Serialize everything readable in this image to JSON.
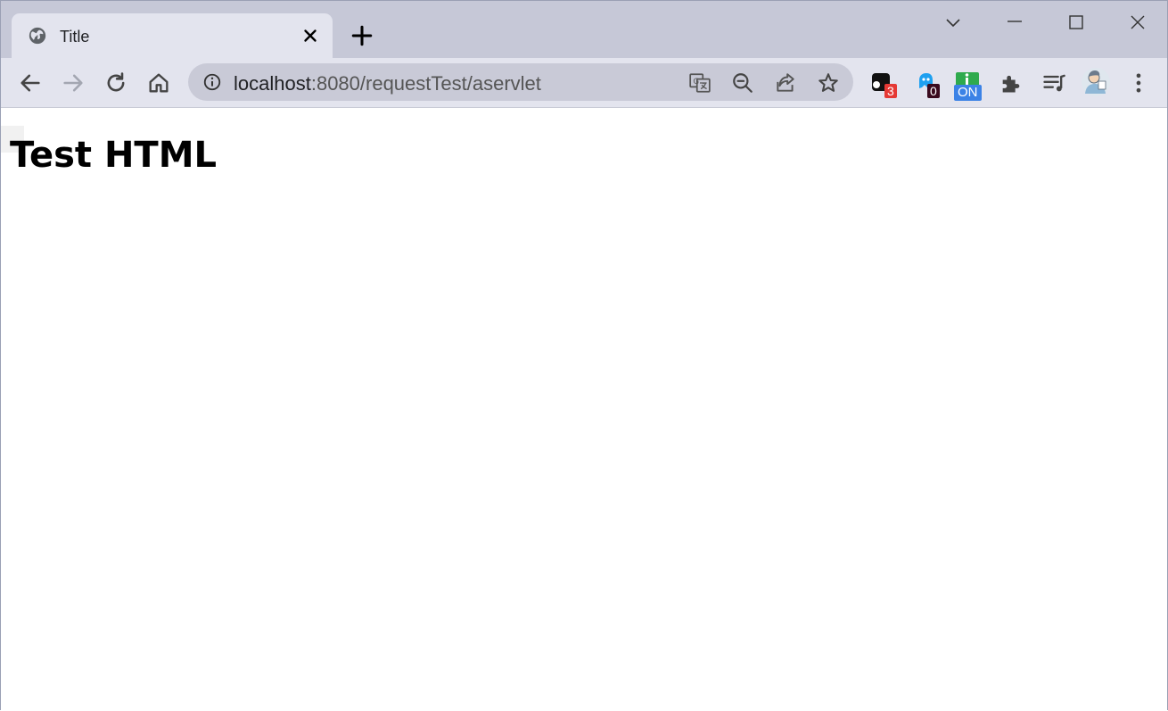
{
  "browser": {
    "tab": {
      "title": "Title",
      "favicon": "globe-icon"
    },
    "address": {
      "host": "localhost",
      "rest": ":8080/requestTest/aservlet"
    },
    "extensions": [
      {
        "name": "extension-dark",
        "badge": "3",
        "badge_color": "#e53935"
      },
      {
        "name": "extension-ghost",
        "badge": "0",
        "badge_color": "#3a0a1e"
      },
      {
        "name": "extension-info",
        "badge": "ON",
        "badge_color": "#3b82e6"
      }
    ]
  },
  "page": {
    "heading": "Test HTML"
  }
}
